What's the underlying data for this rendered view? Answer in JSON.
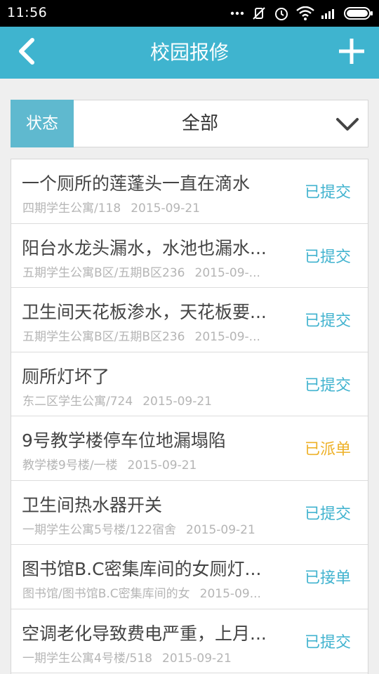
{
  "status_bar": {
    "time": "11:56"
  },
  "header": {
    "title": "校园报修"
  },
  "filter": {
    "label": "状态",
    "value": "全部"
  },
  "colors": {
    "accent": "#3fb4cf",
    "dispatched": "#eeb128",
    "submitted": "#41b3cf"
  },
  "items": [
    {
      "title": "一个厕所的莲蓬头一直在滴水",
      "location": "四期学生公寓/118",
      "date": "2015-09-21",
      "status": "已提交",
      "status_type": "submitted"
    },
    {
      "title": "阳台水龙头漏水，水池也漏水...",
      "location": "五期学生公寓B区/五期B区236",
      "date": "2015-09-...",
      "status": "已提交",
      "status_type": "submitted"
    },
    {
      "title": "卫生间天花板渗水，天花板要...",
      "location": "五期学生公寓B区/五期B区236",
      "date": "2015-09-...",
      "status": "已提交",
      "status_type": "submitted"
    },
    {
      "title": "厕所灯坏了",
      "location": "东二区学生公寓/724",
      "date": "2015-09-21",
      "status": "已提交",
      "status_type": "submitted"
    },
    {
      "title": "9号教学楼停车位地漏塌陷",
      "location": "教学楼9号楼/一楼",
      "date": "2015-09-21",
      "status": "已派单",
      "status_type": "dispatched"
    },
    {
      "title": "卫生间热水器开关",
      "location": "一期学生公寓5号楼/122宿舍",
      "date": "2015-09-21",
      "status": "已提交",
      "status_type": "submitted"
    },
    {
      "title": "图书馆B.C密集库间的女厕灯...",
      "location": "图书馆/图书馆B.C密集库间的女",
      "date": "2015-09...",
      "status": "已接单",
      "status_type": "accepted"
    },
    {
      "title": "空调老化导致费电严重，上月...",
      "location": "一期学生公寓4号楼/518",
      "date": "2015-09-21",
      "status": "已提交",
      "status_type": "submitted"
    }
  ]
}
